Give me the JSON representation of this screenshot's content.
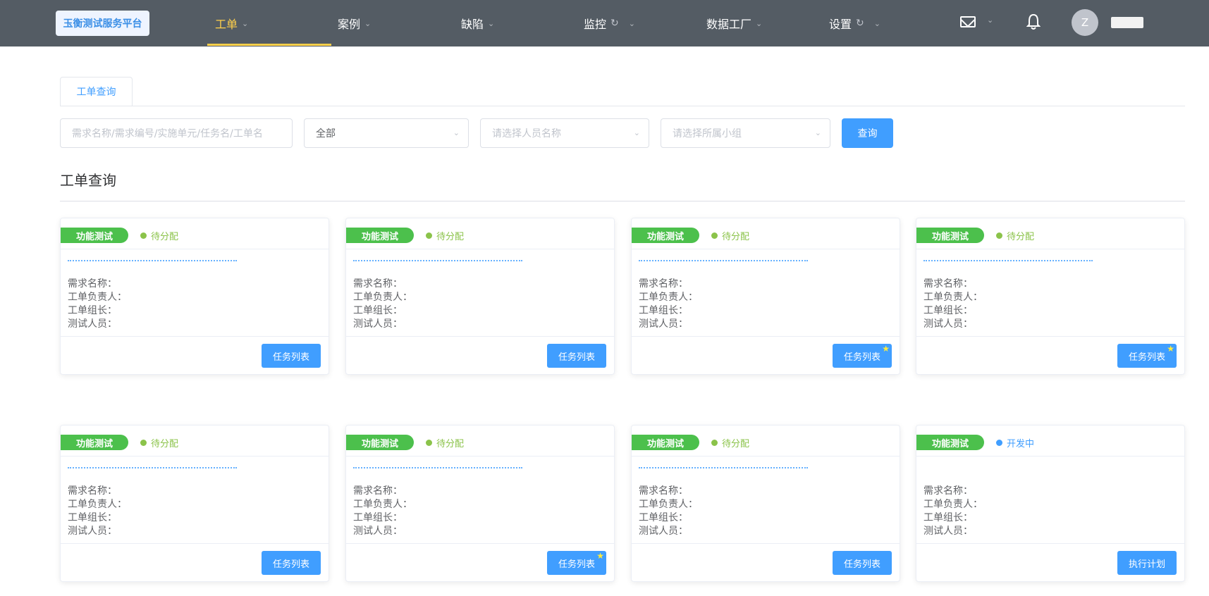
{
  "header": {
    "logo": "玉衡测试服务平台",
    "nav": [
      {
        "label": "工单",
        "active": true,
        "refresh": false
      },
      {
        "label": "案例",
        "active": false,
        "refresh": false
      },
      {
        "label": "缺陷",
        "active": false,
        "refresh": false
      },
      {
        "label": "监控",
        "active": false,
        "refresh": true
      },
      {
        "label": "数据工厂",
        "active": false,
        "refresh": false
      },
      {
        "label": "设置",
        "active": false,
        "refresh": true
      }
    ],
    "avatar_initial": "Z",
    "accent": "#ffd04b"
  },
  "tabs": [
    {
      "label": "工单查询"
    }
  ],
  "filters": {
    "search_placeholder": "需求名称/需求编号/实施单元/任务名/工单名",
    "status_value": "全部",
    "person_placeholder": "请选择人员名称",
    "group_placeholder": "请选择所属小组",
    "query_label": "查询"
  },
  "section_title": "工单查询",
  "field_labels": {
    "req_name": "需求名称：",
    "owner": "工单负责人：",
    "leader": "工单组长：",
    "testers": "测试人员："
  },
  "cards": [
    {
      "type": "功能测试",
      "status": "待分配",
      "status_color": "#8bc34a",
      "button": "任务列表",
      "star": false
    },
    {
      "type": "功能测试",
      "status": "待分配",
      "status_color": "#8bc34a",
      "button": "任务列表",
      "star": false
    },
    {
      "type": "功能测试",
      "status": "待分配",
      "status_color": "#8bc34a",
      "button": "任务列表",
      "star": true
    },
    {
      "type": "功能测试",
      "status": "待分配",
      "status_color": "#8bc34a",
      "button": "任务列表",
      "star": true
    },
    {
      "type": "功能测试",
      "status": "待分配",
      "status_color": "#8bc34a",
      "button": "任务列表",
      "star": false
    },
    {
      "type": "功能测试",
      "status": "待分配",
      "status_color": "#8bc34a",
      "button": "任务列表",
      "star": true
    },
    {
      "type": "功能测试",
      "status": "待分配",
      "status_color": "#8bc34a",
      "button": "任务列表",
      "star": false
    },
    {
      "type": "功能测试",
      "status": "开发中",
      "status_color": "#409eff",
      "button": "执行计划",
      "star": false
    }
  ]
}
